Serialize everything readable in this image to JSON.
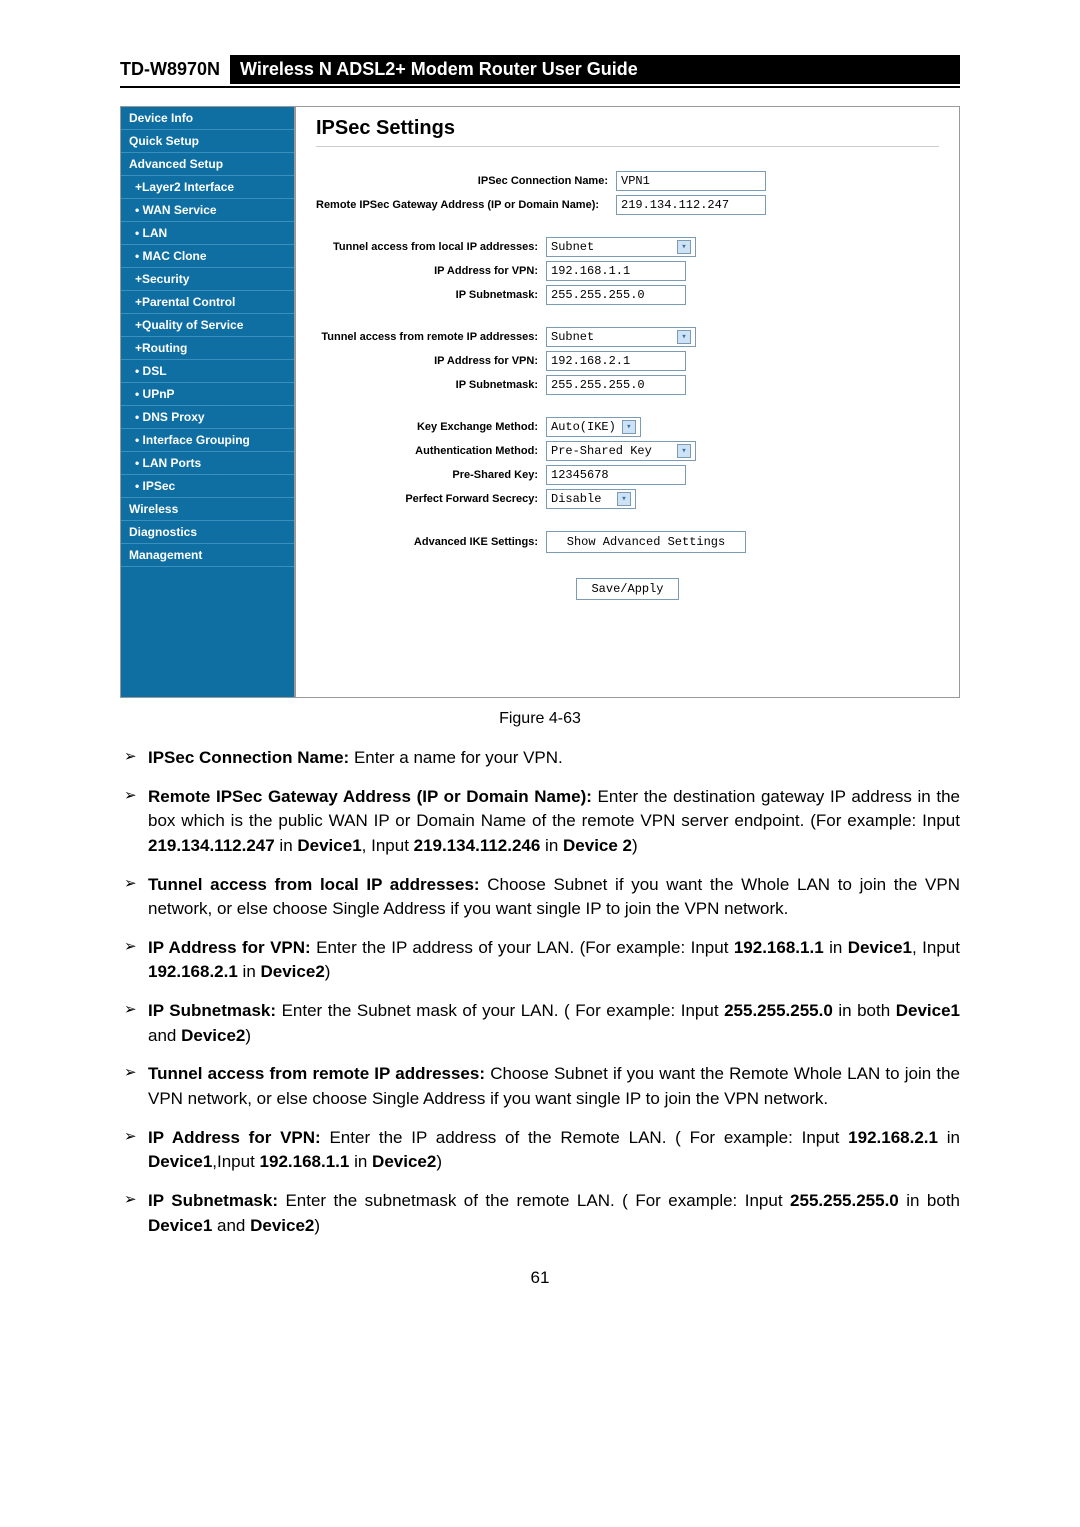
{
  "header": {
    "model": "TD-W8970N",
    "title": "Wireless  N  ADSL2+  Modem  Router  User  Guide"
  },
  "sidebar": {
    "items": [
      {
        "label": "Device Info",
        "sub": false
      },
      {
        "label": "Quick Setup",
        "sub": false
      },
      {
        "label": "Advanced Setup",
        "sub": false
      },
      {
        "label": "+Layer2 Interface",
        "sub": true
      },
      {
        "label": "• WAN Service",
        "sub": true
      },
      {
        "label": "• LAN",
        "sub": true
      },
      {
        "label": "• MAC Clone",
        "sub": true
      },
      {
        "label": "+Security",
        "sub": true
      },
      {
        "label": "+Parental Control",
        "sub": true
      },
      {
        "label": "+Quality of Service",
        "sub": true
      },
      {
        "label": "+Routing",
        "sub": true
      },
      {
        "label": "• DSL",
        "sub": true
      },
      {
        "label": "• UPnP",
        "sub": true
      },
      {
        "label": "• DNS Proxy",
        "sub": true
      },
      {
        "label": "• Interface Grouping",
        "sub": true
      },
      {
        "label": "• LAN Ports",
        "sub": true
      },
      {
        "label": "• IPSec",
        "sub": true
      },
      {
        "label": "Wireless",
        "sub": false
      },
      {
        "label": "Diagnostics",
        "sub": false
      },
      {
        "label": "Management",
        "sub": false
      }
    ]
  },
  "form": {
    "title": "IPSec Settings",
    "labels": {
      "conn_name": "IPSec Connection Name:",
      "remote_gw": "Remote IPSec Gateway Address (IP or Domain Name):",
      "tunnel_local": "Tunnel access from local IP addresses:",
      "ip_vpn": "IP Address for VPN:",
      "subnet": "IP Subnetmask:",
      "tunnel_remote": "Tunnel access from remote IP addresses:",
      "kex": "Key Exchange Method:",
      "auth": "Authentication Method:",
      "psk": "Pre-Shared Key:",
      "pfs": "Perfect Forward Secrecy:",
      "adv": "Advanced IKE Settings:"
    },
    "values": {
      "conn_name": "VPN1",
      "remote_gw": "219.134.112.247",
      "tunnel_local": "Subnet",
      "local_ip": "192.168.1.1",
      "local_mask": "255.255.255.0",
      "tunnel_remote": "Subnet",
      "remote_ip": "192.168.2.1",
      "remote_mask": "255.255.255.0",
      "kex": "Auto(IKE)",
      "auth": "Pre-Shared Key",
      "psk": "12345678",
      "pfs": "Disable",
      "adv_btn": "Show Advanced Settings",
      "save_btn": "Save/Apply"
    }
  },
  "figure_caption": "Figure 4-63",
  "notes": {
    "n1a": "IPSec Connection Name: ",
    "n1b": "Enter a name for your VPN.",
    "n2a": "Remote IPSec Gateway Address (IP or Domain Name): ",
    "n2b": "Enter the destination gateway IP address in the box which is the public WAN IP or Domain Name of the remote VPN server endpoint. (For example: Input ",
    "n2c": "219.134.112.247",
    "n2d": " in ",
    "n2e": "Device1",
    "n2f": ", Input ",
    "n2g": "219.134.112.246",
    "n2h": " in ",
    "n2i": "Device 2",
    "n2j": ")",
    "n3a": "Tunnel access from local IP addresses: ",
    "n3b": "Choose Subnet if you want the Whole LAN to join the VPN network, or else choose Single Address if you want single IP to join the VPN network.",
    "n4a": "IP Address for VPN: ",
    "n4b": "Enter the IP address of your LAN. (For example: Input ",
    "n4c": "192.168.1.1",
    "n4d": " in ",
    "n4e": "Device1",
    "n4f": ", Input ",
    "n4g": "192.168.2.1",
    "n4h": " in ",
    "n4i": "Device2",
    "n4j": ")",
    "n5a": "IP Subnetmask: ",
    "n5b": "Enter the Subnet mask of your LAN. ( For example: Input ",
    "n5c": "255.255.255.0",
    "n5d": " in both ",
    "n5e": "Device1",
    "n5f": " and ",
    "n5g": "Device2",
    "n5h": ")",
    "n6a": "Tunnel access from remote IP addresses: ",
    "n6b": "Choose Subnet if you want the Remote Whole LAN to join the VPN network, or else choose Single Address if you want single IP to join the VPN network.",
    "n7a": "IP Address for VPN: ",
    "n7b": "Enter the IP address of the Remote LAN. ( For example: Input ",
    "n7c": "192.168.2.1",
    "n7d": " in ",
    "n7e": "Device1",
    "n7f": ",Input ",
    "n7g": "192.168.1.1",
    "n7h": " in ",
    "n7i": "Device2",
    "n7j": ")",
    "n8a": "IP Subnetmask: ",
    "n8b": "Enter the subnetmask of the remote LAN. ( For example: Input ",
    "n8c": "255.255.255.0",
    "n8d": " in both ",
    "n8e": "Device1",
    "n8f": " and ",
    "n8g": "Device2",
    "n8h": ")"
  },
  "page_number": "61"
}
